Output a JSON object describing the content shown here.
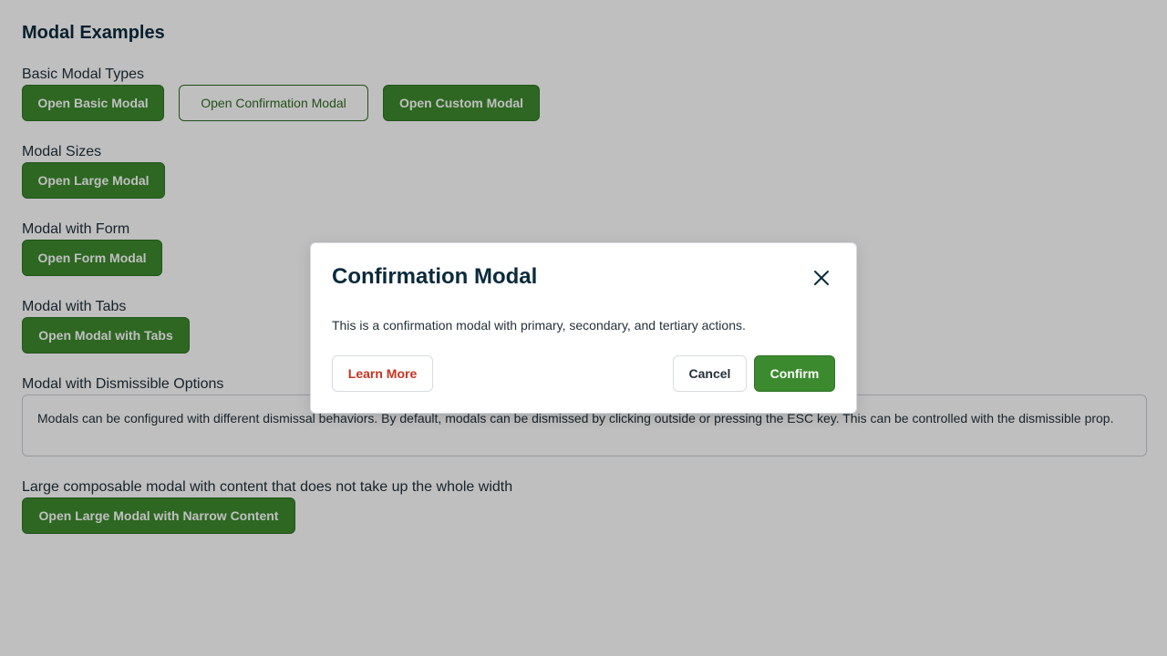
{
  "page": {
    "title": "Modal Examples",
    "sections": {
      "basic": {
        "label": "Basic Modal Types",
        "buttons": [
          "Open Basic Modal",
          "Open Confirmation Modal",
          "Open Custom Modal"
        ]
      },
      "sizes": {
        "label": "Modal Sizes",
        "button": "Open Large Modal"
      },
      "form": {
        "label": "Modal with Form",
        "button": "Open Form Modal"
      },
      "tabs": {
        "label": "Modal with Tabs",
        "button": "Open Modal with Tabs"
      },
      "dismissible": {
        "label": "Modal with Dismissible Options",
        "description": "Modals can be configured with different dismissal behaviors. By default, modals can be dismissed by clicking outside or pressing the ESC key. This can be controlled with the dismissible prop."
      },
      "composable": {
        "label": "Large composable modal with content that does not take up the whole width",
        "button": "Open Large Modal with Narrow Content"
      }
    }
  },
  "modal": {
    "title": "Confirmation Modal",
    "close_icon": "close-icon",
    "body": "This is a confirmation modal with primary, secondary, and tertiary actions.",
    "tertiary_label": "Learn More",
    "cancel_label": "Cancel",
    "confirm_label": "Confirm"
  },
  "colors": {
    "primary": "#3c8a2e",
    "danger_text": "#c8321f",
    "heading": "#0b2a3c"
  }
}
